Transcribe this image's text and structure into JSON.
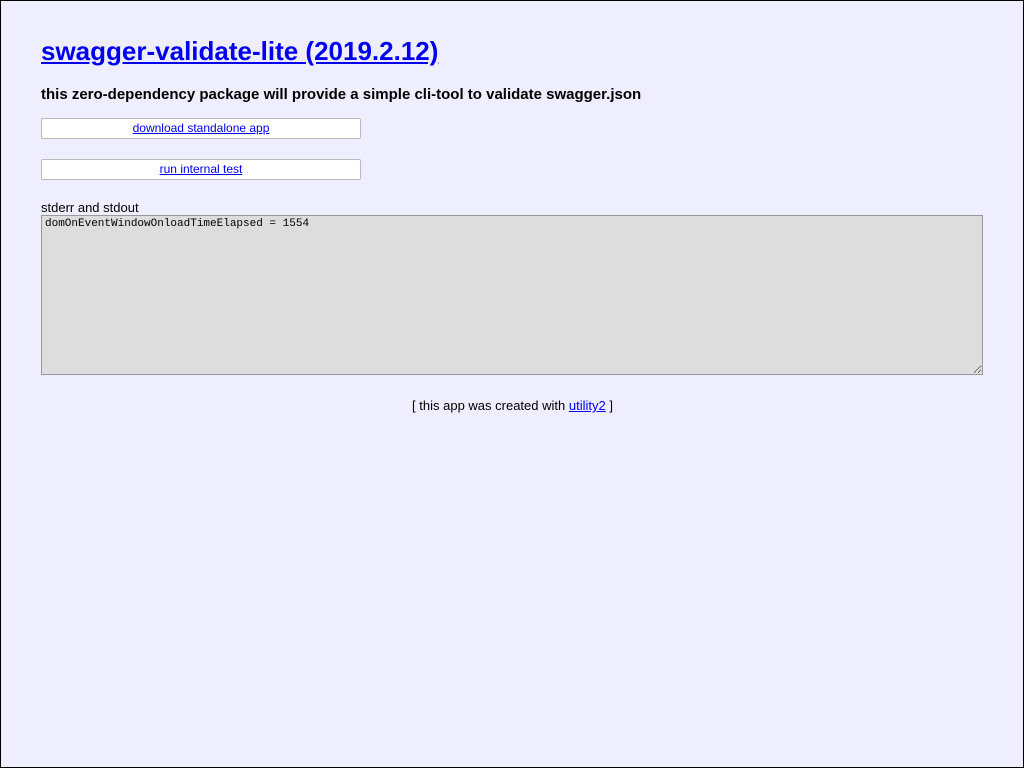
{
  "header": {
    "title": "swagger-validate-lite (2019.2.12)",
    "description": "this zero-dependency package will provide a simple cli-tool to validate swagger.json"
  },
  "actions": {
    "download_label": "download standalone app",
    "test_label": "run internal test"
  },
  "output": {
    "label": "stderr and stdout",
    "text": "domOnEventWindowOnloadTimeElapsed = 1554"
  },
  "footer": {
    "prefix": "[ this app was created with ",
    "link_text": "utility2",
    "suffix": " ]"
  },
  "colors": {
    "background": "#eeeeff",
    "link": "#0000ee",
    "output_background": "#dddddd"
  }
}
